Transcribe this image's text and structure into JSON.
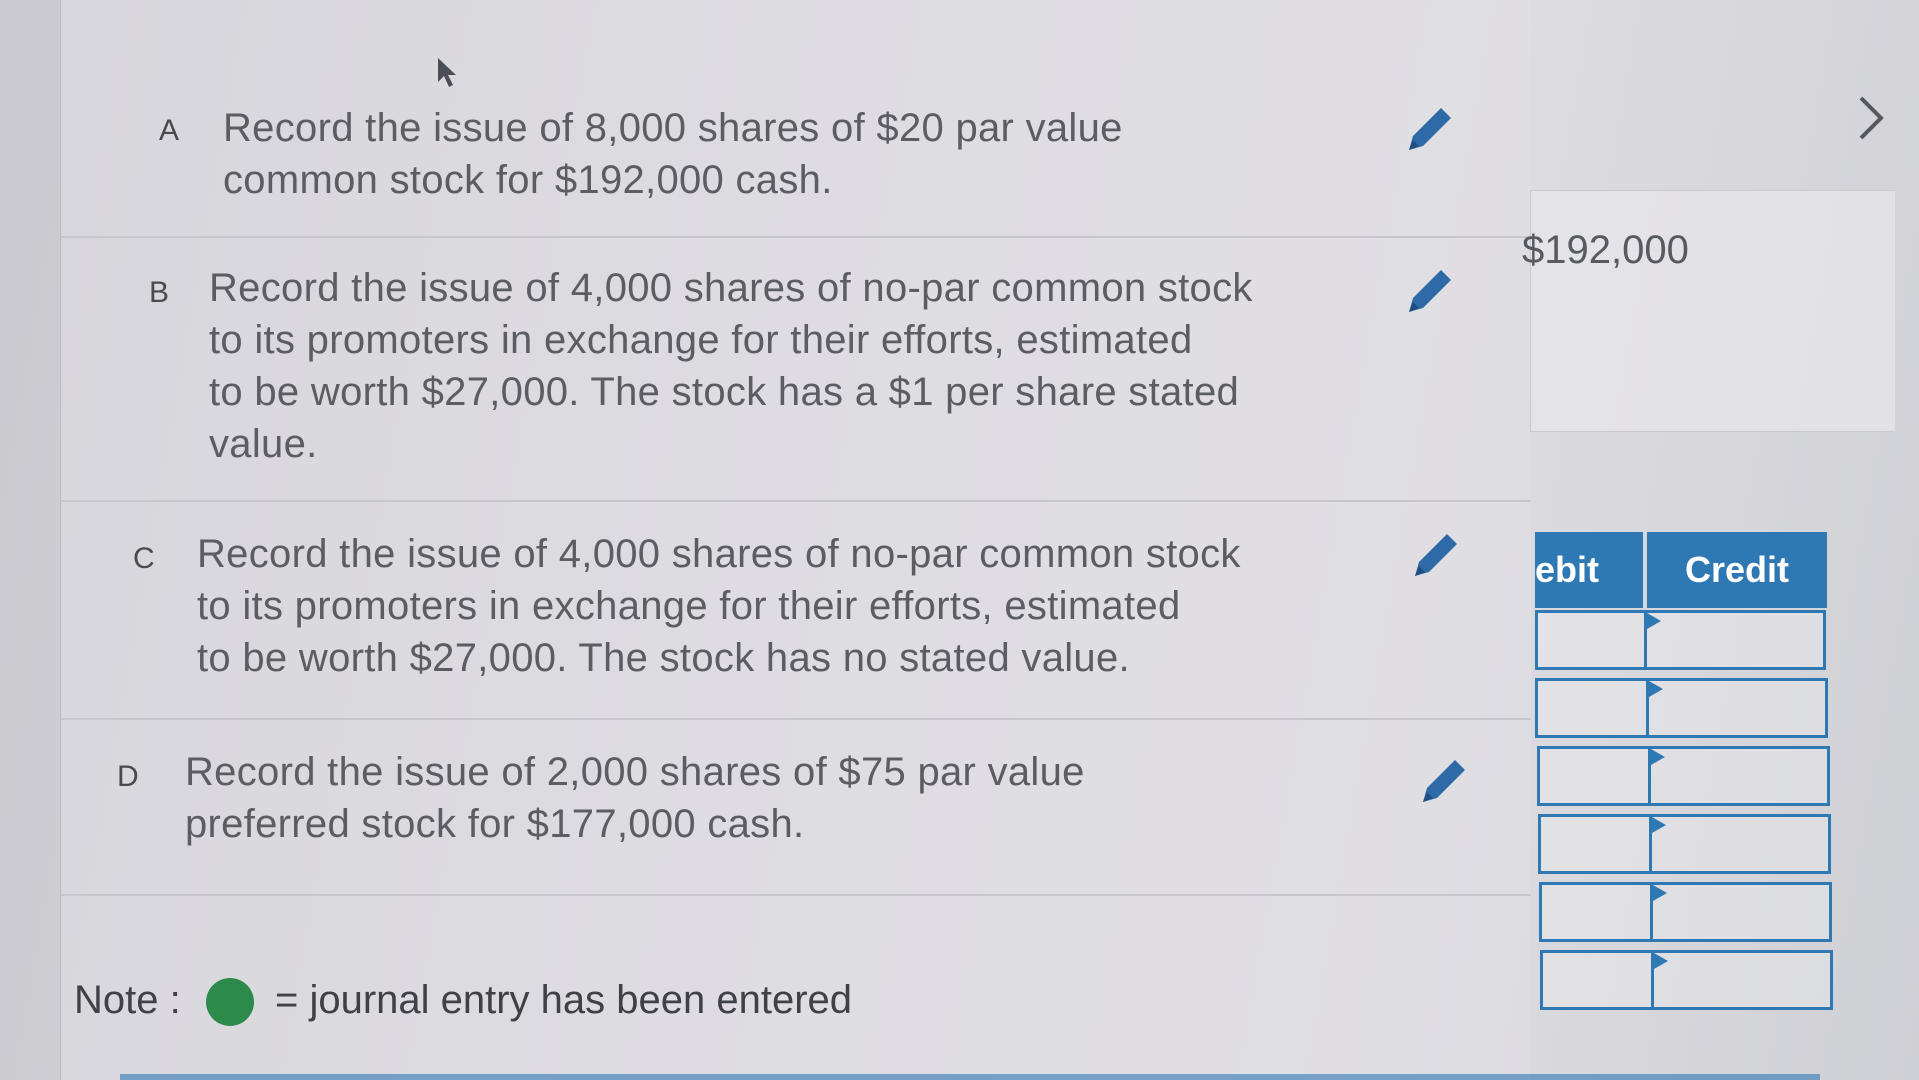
{
  "rows": [
    {
      "letter": "A",
      "text_lines": [
        "Record the issue of 8,000 shares of $20 par value",
        "common stock for $192,000 cash."
      ]
    },
    {
      "letter": "B",
      "text_lines": [
        "Record the issue of 4,000 shares of no-par common stock",
        "to its promoters in exchange for their efforts, estimated",
        "to be worth $27,000. The stock has a $1 per share stated",
        "value."
      ]
    },
    {
      "letter": "C",
      "text_lines": [
        "Record the issue of 4,000 shares of no-par common stock",
        "to its promoters in exchange for their efforts, estimated",
        "to be worth $27,000. The stock has no stated value."
      ]
    },
    {
      "letter": "D",
      "text_lines": [
        "Record the issue of 2,000 shares of $75 par value",
        "preferred stock for $177,000 cash."
      ]
    }
  ],
  "amount": "$192,000",
  "grid": {
    "debit_header": "ebit",
    "credit_header": "Credit"
  },
  "note": {
    "label": "Note :",
    "text": "= journal entry has been entered"
  },
  "icons": {
    "edit": "pencil-icon",
    "next": "chevron-right-icon",
    "entered_indicator": "green-dot-icon"
  },
  "colors": {
    "accent": "#2e78b3",
    "entered": "#2c8b4a"
  }
}
